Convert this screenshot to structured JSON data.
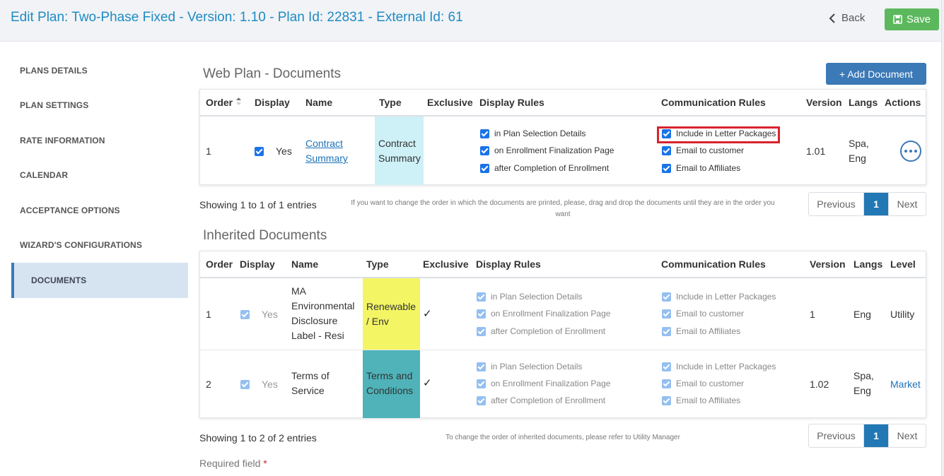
{
  "header": {
    "title": "Edit Plan: Two-Phase Fixed - Version: 1.10 - Plan Id: 22831 - External Id: 61",
    "back_label": "Back",
    "save_label": "Save"
  },
  "sidebar": {
    "items": [
      {
        "label": "PLANS DETAILS"
      },
      {
        "label": "PLAN SETTINGS"
      },
      {
        "label": "RATE INFORMATION"
      },
      {
        "label": "CALENDAR"
      },
      {
        "label": "ACCEPTANCE OPTIONS"
      },
      {
        "label": "WIZARD'S CONFIGURATIONS"
      },
      {
        "label": "DOCUMENTS",
        "active": true
      }
    ]
  },
  "web_docs": {
    "title": "Web Plan - Documents",
    "add_label": "+ Add Document",
    "columns": [
      "Order",
      "Display",
      "Name",
      "Type",
      "Exclusive",
      "Display Rules",
      "Communication Rules",
      "Version",
      "Langs",
      "Actions"
    ],
    "rows": [
      {
        "order": "1",
        "display": "Yes",
        "name_line1": "Contract",
        "name_line2": "Summary",
        "type_line1": "Contract",
        "type_line2": "Summary",
        "type_color": "#cdf1f6",
        "display_rules": [
          "in Plan Selection Details",
          "on Enrollment Finalization Page",
          "after Completion of Enrollment"
        ],
        "comm_rules": [
          "Include in Letter Packages",
          "Email to customer",
          "Email to Affiliates"
        ],
        "version": "1.01",
        "langs_line1": "Spa,",
        "langs_line2": "Eng"
      }
    ],
    "showing": "Showing 1 to 1 of 1 entries",
    "note": "If you want to change the order in which the documents are printed, please, drag and drop the documents until they are in the order you want",
    "pager": {
      "previous": "Previous",
      "current": "1",
      "next": "Next"
    }
  },
  "inherited_docs": {
    "title": "Inherited Documents",
    "columns": [
      "Order",
      "Display",
      "Name",
      "Type",
      "Exclusive",
      "Display Rules",
      "Communication Rules",
      "Version",
      "Langs",
      "Level"
    ],
    "rows": [
      {
        "order": "1",
        "display": "Yes",
        "name_lines": [
          "MA",
          "Environmental",
          "Disclosure",
          "Label - Resi"
        ],
        "type_line1": "Renewable",
        "type_line2": "/ Env",
        "type_color": "#f3f564",
        "exclusive": "✓",
        "display_rules": [
          "in Plan Selection Details",
          "on Enrollment Finalization Page",
          "after Completion of Enrollment"
        ],
        "comm_rules": [
          "Include in Letter Packages",
          "Email to customer",
          "Email to Affiliates"
        ],
        "version": "1",
        "langs_line1": "Eng",
        "level": "Utility"
      },
      {
        "order": "2",
        "display": "Yes",
        "name_lines": [
          "Terms of",
          "Service"
        ],
        "type_line1": "Terms and",
        "type_line2": "Conditions",
        "type_color": "#4fb3b9",
        "exclusive": "✓",
        "display_rules": [
          "in Plan Selection Details",
          "on Enrollment Finalization Page",
          "after Completion of Enrollment"
        ],
        "comm_rules": [
          "Include in Letter Packages",
          "Email to customer",
          "Email to Affiliates"
        ],
        "version": "1.02",
        "langs_line1": "Spa,",
        "langs_line2": "Eng",
        "level": "Market"
      }
    ],
    "showing": "Showing 1 to 2 of 2 entries",
    "note": "To change the order of inherited documents, please refer to Utility Manager",
    "pager": {
      "previous": "Previous",
      "current": "1",
      "next": "Next"
    }
  },
  "footer": {
    "required_label": "Required field",
    "required_star": "*"
  },
  "icons": {
    "back": "chevron-left-icon",
    "save": "floppy-disk-icon",
    "sort": "sort-icon",
    "actions": "ellipsis-icon",
    "check": "checkmark-icon"
  },
  "colors": {
    "accent": "#1e8bc3",
    "primary": "#3b79b7",
    "success": "#5cb85c",
    "highlight": "#d9232d"
  }
}
